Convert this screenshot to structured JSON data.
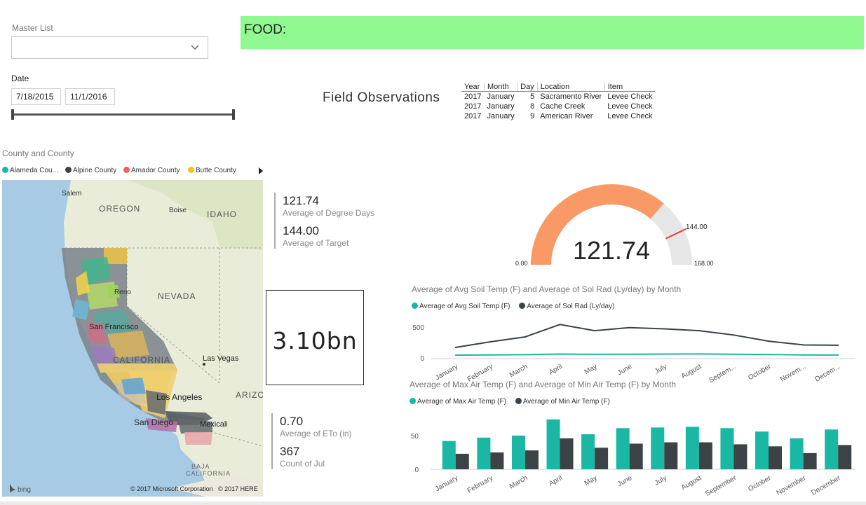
{
  "master_list": {
    "label": "Master List",
    "value": ""
  },
  "food_banner": {
    "text": "FOOD:"
  },
  "date_slicer": {
    "label": "Date",
    "start": "7/18/2015",
    "end": "11/1/2016"
  },
  "field_observations": {
    "title": "Field Observations",
    "columns": [
      "Year",
      "Month",
      "Day",
      "Location",
      "Item"
    ],
    "rows": [
      [
        "2017",
        "January",
        "5",
        "Sacramento River",
        "Levee Check"
      ],
      [
        "2017",
        "January",
        "8",
        "Cache Creek",
        "Levee Check"
      ],
      [
        "2017",
        "January",
        "9",
        "American River",
        "Levee Check"
      ]
    ]
  },
  "map": {
    "title": "County and County",
    "legend": [
      {
        "label": "Alameda Cou...",
        "color": "#1ab7a4"
      },
      {
        "label": "Alpine County",
        "color": "#3b4346"
      },
      {
        "label": "Amador County",
        "color": "#ef6060"
      },
      {
        "label": "Butte County",
        "color": "#f4c21f"
      }
    ],
    "places": {
      "salem": "Salem",
      "oregon": "OREGON",
      "boise": "Boise",
      "idaho": "IDAHO",
      "nevada": "NEVADA",
      "reno": "Reno",
      "san_francisco": "San Francisco",
      "california": "CALIFORNIA",
      "las_vegas": "Las Vegas",
      "arizona": "ARIZO",
      "los_angeles": "Los Angeles",
      "san_diego": "San Diego",
      "mexicali": "Mexicali",
      "baja": "BAJA",
      "california2": "CALIFORNIA"
    },
    "bing": "bing",
    "copyright_ms": "© 2017 Microsoft Corporation",
    "copyright_here": "© 2017 HERE"
  },
  "kpi_top": {
    "value1": "121.74",
    "label1": "Average of Degree Days",
    "value2": "144.00",
    "label2": "Average of Target"
  },
  "card": {
    "value": "3.10bn"
  },
  "kpi_bottom": {
    "value1": "0.70",
    "label1": "Average of ETo (in)",
    "value2": "367",
    "label2": "Count of Jul"
  },
  "gauge": {
    "value": 121.74,
    "value_label": "121.74",
    "min": 0,
    "min_label": "0.00",
    "max": 168,
    "max_label": "168.00",
    "target": 144,
    "target_label": "144.00",
    "fill_color": "#f99a66",
    "track_color": "#e6e6e6",
    "target_color": "#e04040"
  },
  "line_chart": {
    "title": "Average of Avg Soil Temp (F) and Average of Sol Rad (Ly/day) by Month",
    "legend": [
      {
        "label": "Average of Avg Soil Temp (F)",
        "color": "#1ab7a4"
      },
      {
        "label": "Average of Sol Rad (Ly/day)",
        "color": "#3b4346"
      }
    ],
    "categories": [
      "January",
      "February",
      "March",
      "April",
      "May",
      "June",
      "July",
      "August",
      "Septem...",
      "October",
      "Novem...",
      "Decem..."
    ]
  },
  "bar_chart": {
    "title": "Average of Max Air Temp (F) and Average of Min Air Temp (F) by Month",
    "legend": [
      {
        "label": "Average of Max Air Temp (F)",
        "color": "#1ab7a4"
      },
      {
        "label": "Average of Min Air Temp (F)",
        "color": "#3b4346"
      }
    ],
    "categories": [
      "January",
      "February",
      "March",
      "April",
      "May",
      "June",
      "July",
      "August",
      "September",
      "October",
      "November",
      "December"
    ]
  },
  "chart_data": [
    {
      "type": "line",
      "title": "Average of Avg Soil Temp (F) and Average of Sol Rad (Ly/day) by Month",
      "categories": [
        "January",
        "February",
        "March",
        "April",
        "May",
        "June",
        "July",
        "August",
        "Septem...",
        "October",
        "Novem...",
        "Decem..."
      ],
      "ylim": [
        0,
        600
      ],
      "yticks": [
        0,
        500
      ],
      "series": [
        {
          "name": "Average of Avg Soil Temp (F)",
          "color": "#1ab7a4",
          "values": [
            45,
            48,
            52,
            62,
            58,
            60,
            62,
            63,
            60,
            55,
            48,
            46
          ]
        },
        {
          "name": "Average of Sol Rad (Ly/day)",
          "color": "#3b4346",
          "values": [
            170,
            260,
            340,
            540,
            440,
            490,
            470,
            440,
            370,
            270,
            210,
            205
          ]
        }
      ]
    },
    {
      "type": "bar",
      "title": "Average of Max Air Temp (F) and Average of Min Air Temp (F) by Month",
      "categories": [
        "January",
        "February",
        "March",
        "April",
        "May",
        "June",
        "July",
        "August",
        "September",
        "October",
        "November",
        "December"
      ],
      "ylim": [
        0,
        80
      ],
      "yticks": [
        0,
        50
      ],
      "series": [
        {
          "name": "Average of Max Air Temp (F)",
          "color": "#1ab7a4",
          "values": [
            42,
            47,
            50,
            74,
            52,
            61,
            62,
            63,
            61,
            56,
            46,
            59
          ]
        },
        {
          "name": "Average of Min Air Temp (F)",
          "color": "#3b4346",
          "values": [
            23,
            25,
            28,
            46,
            32,
            38,
            40,
            40,
            37,
            34,
            24,
            36
          ]
        }
      ]
    },
    {
      "type": "gauge",
      "value": 121.74,
      "min": 0,
      "max": 168,
      "target": 144
    }
  ]
}
